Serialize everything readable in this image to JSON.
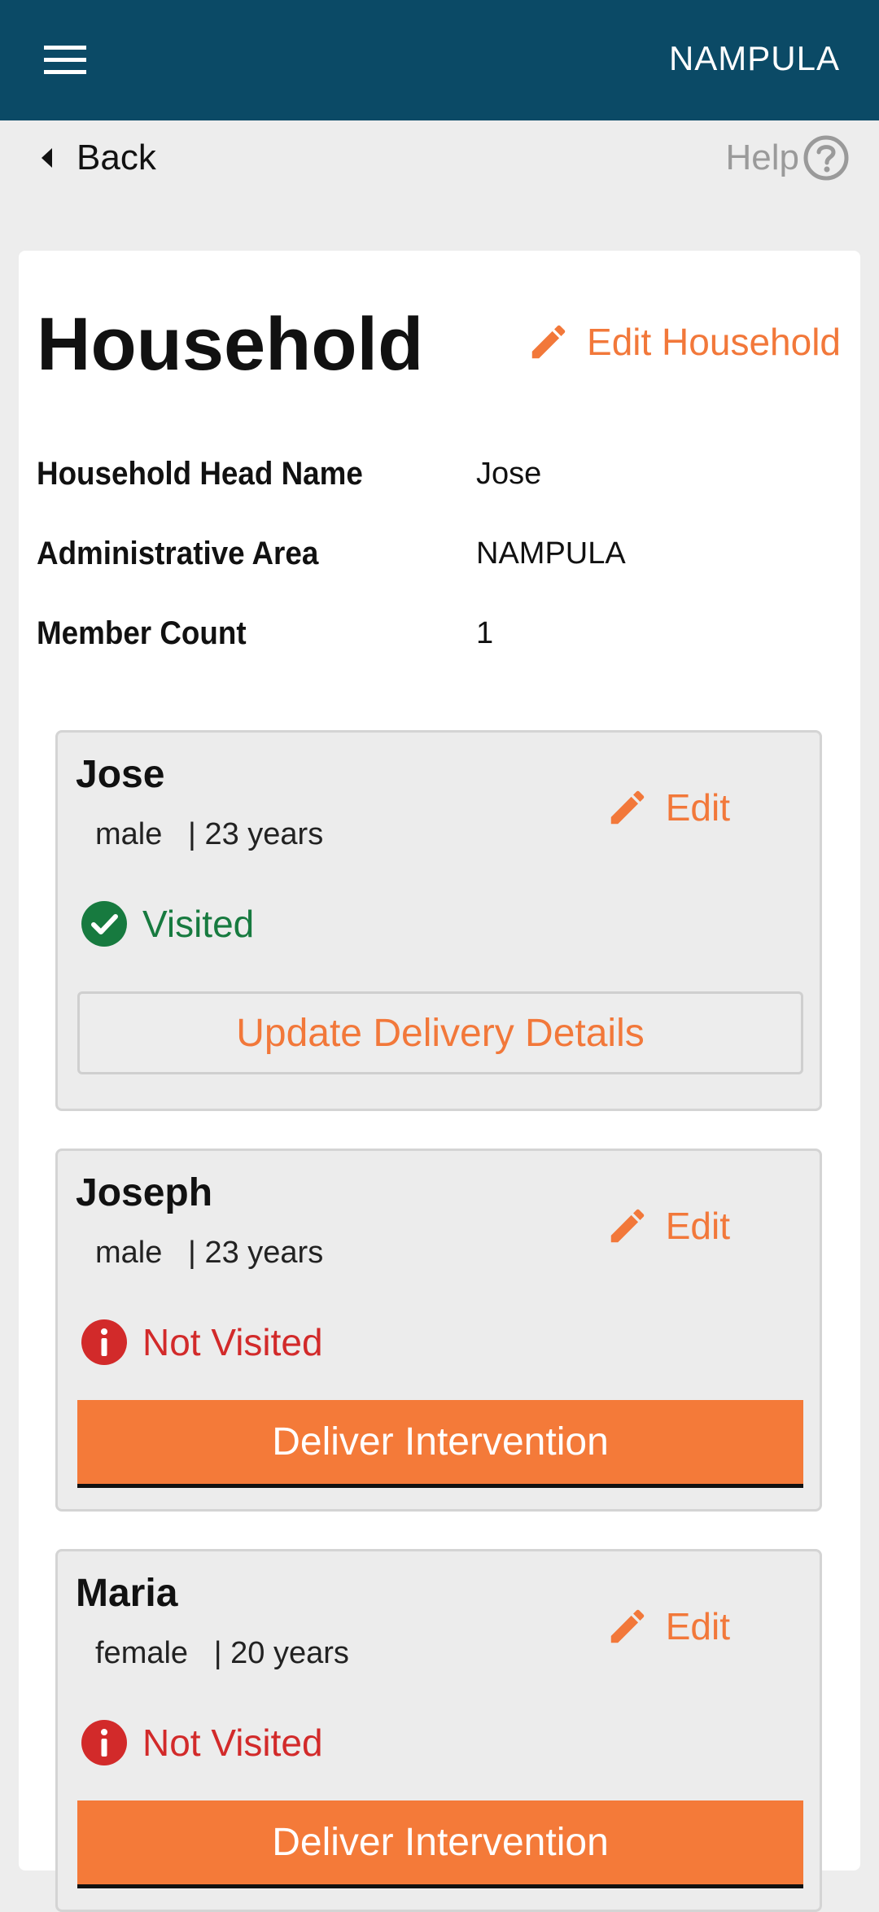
{
  "header": {
    "region": "NAMPULA",
    "menu_icon": "hamburger-menu-icon"
  },
  "nav": {
    "back_label": "Back",
    "help_label": "Help"
  },
  "household": {
    "title": "Household",
    "edit_label": "Edit Household",
    "fields": [
      {
        "label": "Household Head Name",
        "value": "Jose"
      },
      {
        "label": "Administrative Area",
        "value": "NAMPULA"
      },
      {
        "label": "Member Count",
        "value": "1"
      }
    ]
  },
  "members": [
    {
      "name": "Jose",
      "meta": "male   | 23 years",
      "edit_label": "Edit",
      "status": "Visited",
      "action_label": "Update Delivery Details"
    },
    {
      "name": "Joseph",
      "meta": "male   | 23 years",
      "edit_label": "Edit",
      "status": "Not Visited",
      "action_label": "Deliver Intervention"
    },
    {
      "name": "Maria",
      "meta": "female   | 20 years",
      "edit_label": "Edit",
      "status": "Not Visited",
      "action_label": "Deliver Intervention"
    }
  ],
  "colors": {
    "header_bg": "#0b4a66",
    "accent": "#f47a39",
    "visited": "#177a3f",
    "not_visited": "#d22a2a"
  }
}
